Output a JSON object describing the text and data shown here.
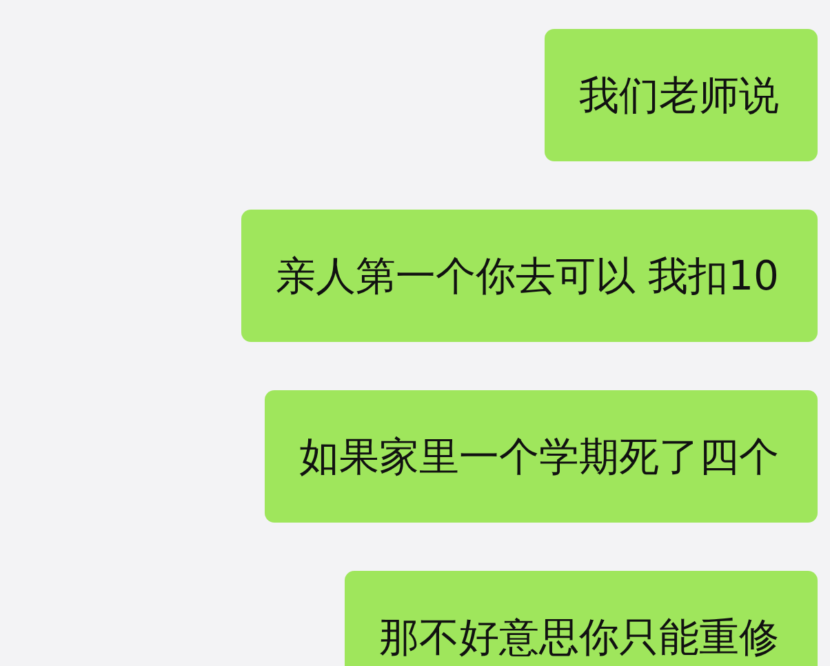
{
  "messages": [
    {
      "text": "我们老师说",
      "outgoing": true
    },
    {
      "text": "亲人第一个你去可以 我扣10",
      "outgoing": true
    },
    {
      "text": "如果家里一个学期死了四个",
      "outgoing": true
    },
    {
      "text": "那不好意思你只能重修",
      "outgoing": true
    }
  ]
}
